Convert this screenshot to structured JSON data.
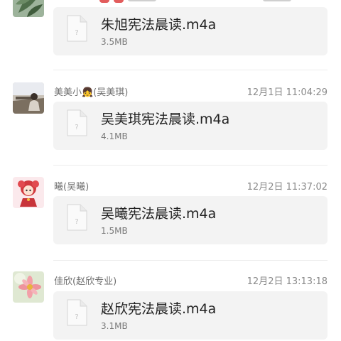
{
  "messages": [
    {
      "sender": "",
      "time": "",
      "file": {
        "name": "朱旭宪法晨读.m4a",
        "size": "3.5MB"
      },
      "avatar": "avatar-leaf"
    },
    {
      "sender": "美美小👧(吴美琪)",
      "time": "12月1日 11:04:29",
      "file": {
        "name": "吴美琪宪法晨读.m4a",
        "size": "4.1MB"
      },
      "avatar": "avatar-photo-bench"
    },
    {
      "sender": "曦(吴曦)",
      "time": "12月2日 11:37:02",
      "file": {
        "name": "吴曦宪法晨读.m4a",
        "size": "1.5MB"
      },
      "avatar": "avatar-cartoon-girl"
    },
    {
      "sender": "佳欣(赵欣专业)",
      "time": "12月2日 13:13:18",
      "file": {
        "name": "赵欣宪法晨读.m4a",
        "size": "3.1MB"
      },
      "avatar": "avatar-flower"
    }
  ],
  "icons": {
    "file": "unknown-file-icon",
    "file_glyph": "?"
  },
  "colors": {
    "card_bg": "#f3f3f3",
    "meta_text": "#8a8a8a"
  }
}
